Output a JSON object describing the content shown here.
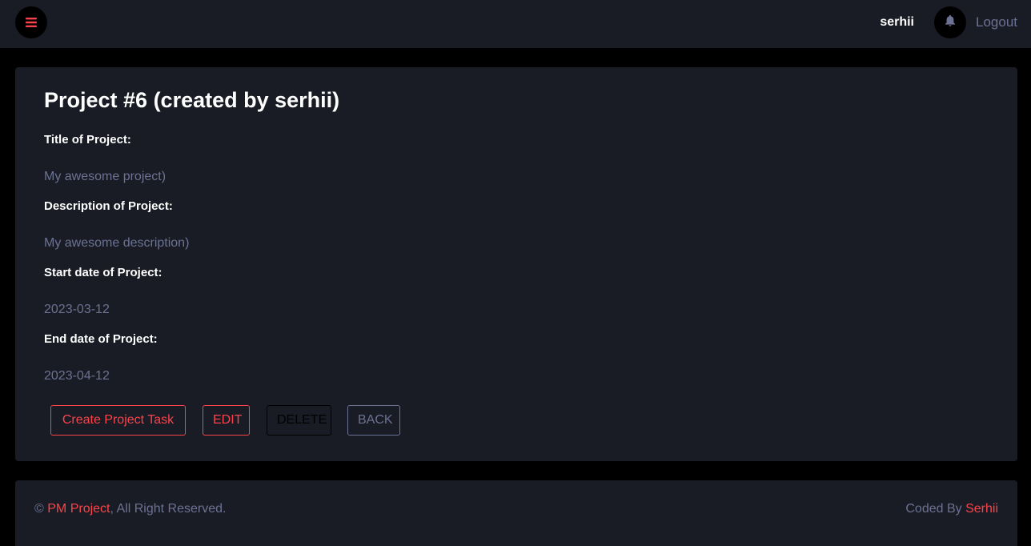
{
  "colors": {
    "background": "#000000",
    "panel": "#191c24",
    "accent": "#fc424a",
    "muted_text": "#6c7293",
    "heading_text": "#ffffff"
  },
  "header": {
    "menu_icon": "hamburger-menu-icon",
    "username": "serhii",
    "notification_icon": "bell-icon",
    "logout_label": "Logout"
  },
  "project": {
    "title": "Project #6 (created by serhii)",
    "fields": [
      {
        "label": "Title of Project:",
        "value": "My awesome project)"
      },
      {
        "label": "Description of Project:",
        "value": "My awesome description)"
      },
      {
        "label": "Start date of Project:",
        "value": "2023-03-12"
      },
      {
        "label": "End date of Project:",
        "value": "2023-04-12"
      }
    ],
    "actions": {
      "create_task": "Create Project Task",
      "edit": "EDIT",
      "delete": "DELETE",
      "back": "BACK"
    }
  },
  "footer": {
    "copyright_symbol": "©",
    "brand": "PM Project",
    "rights": ", All Right Reserved.",
    "coded_by": "Coded By",
    "author": "Serhii"
  }
}
